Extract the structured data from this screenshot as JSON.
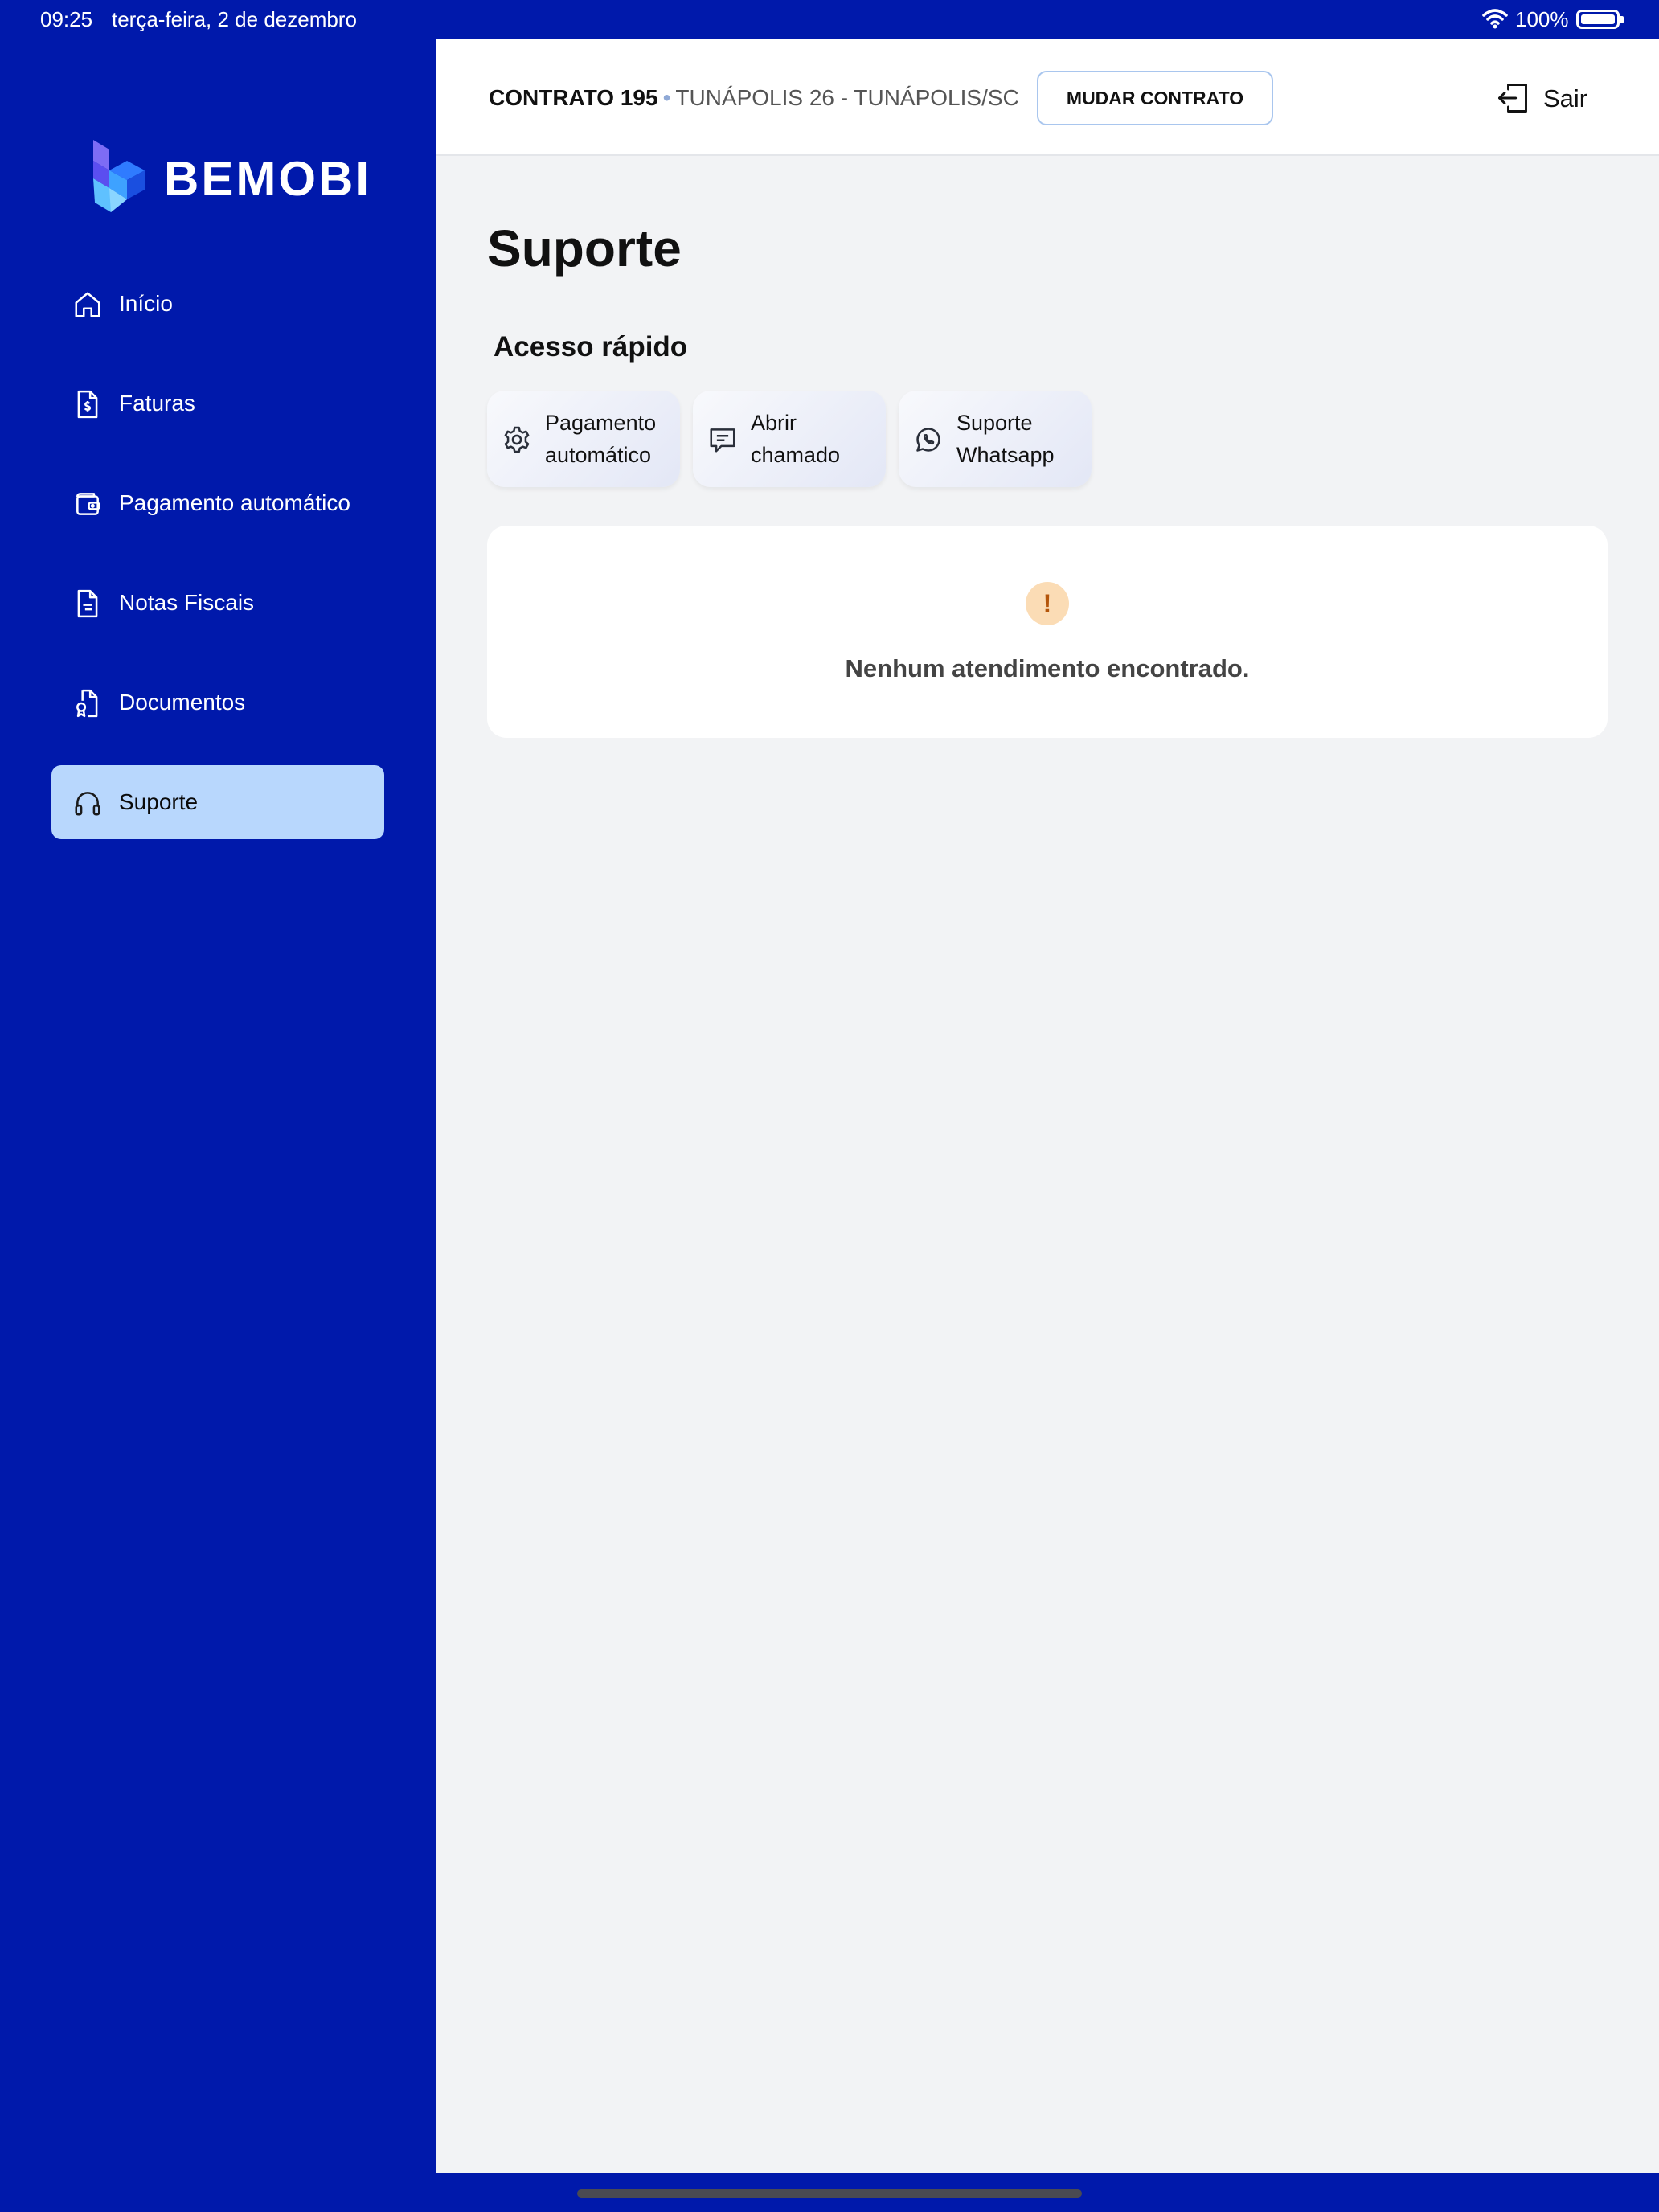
{
  "status_bar": {
    "time": "09:25",
    "date": "terça-feira, 2 de dezembro",
    "battery_percent": "100%",
    "wifi_icon": "wifi-icon",
    "battery_icon": "battery-icon"
  },
  "brand": {
    "name": "BEMOBI",
    "sidebar_color": "#0019ab"
  },
  "sidebar": {
    "items": [
      {
        "label": "Início",
        "icon": "home-icon",
        "active": false
      },
      {
        "label": "Faturas",
        "icon": "invoice-icon",
        "active": false
      },
      {
        "label": "Pagamento automático",
        "icon": "wallet-icon",
        "active": false
      },
      {
        "label": "Notas Fiscais",
        "icon": "document-icon",
        "active": false
      },
      {
        "label": "Documentos",
        "icon": "certificate-icon",
        "active": false
      },
      {
        "label": "Suporte",
        "icon": "headphones-icon",
        "active": true
      }
    ]
  },
  "header": {
    "contract_number": "CONTRATO 195",
    "separator": "•",
    "contract_location": "TUNÁPOLIS 26 - TUNÁPOLIS/SC",
    "change_contract_label": "MUDAR CONTRATO",
    "logout_label": "Sair",
    "logout_icon": "logout-icon"
  },
  "main": {
    "title": "Suporte",
    "quick_access_title": "Acesso rápido",
    "quick_access": [
      {
        "line1": "Pagamento",
        "line2": "automático",
        "icon": "gear-icon"
      },
      {
        "line1": "Abrir",
        "line2": "chamado",
        "icon": "chat-icon"
      },
      {
        "line1": "Suporte",
        "line2": "Whatsapp",
        "icon": "whatsapp-icon"
      }
    ],
    "empty_state": {
      "icon_text": "!",
      "icon": "alert-icon",
      "message": "Nenhum atendimento encontrado."
    }
  }
}
